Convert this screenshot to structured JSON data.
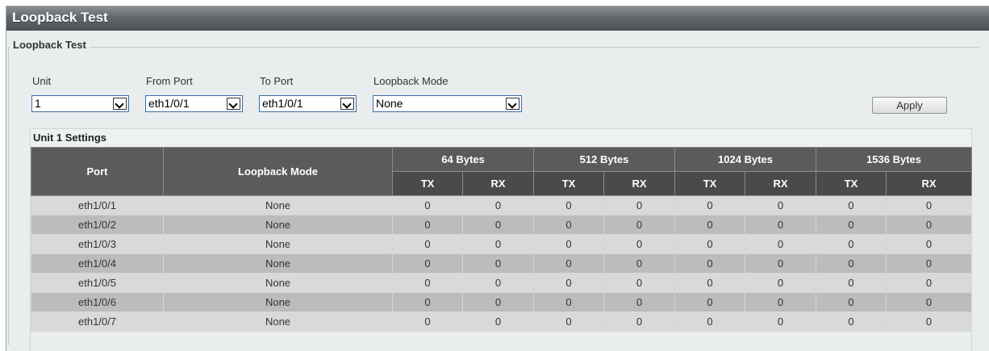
{
  "page": {
    "title": "Loopback Test"
  },
  "form": {
    "legend": "Loopback Test",
    "unit_label": "Unit",
    "unit_value": "1",
    "from_port_label": "From Port",
    "from_port_value": "eth1/0/1",
    "to_port_label": "To Port",
    "to_port_value": "eth1/0/1",
    "mode_label": "Loopback Mode",
    "mode_value": "None",
    "apply_label": "Apply"
  },
  "settings": {
    "title": "Unit 1 Settings",
    "headers": {
      "port": "Port",
      "mode": "Loopback Mode",
      "groups": [
        "64 Bytes",
        "512 Bytes",
        "1024 Bytes",
        "1536 Bytes"
      ],
      "tx": "TX",
      "rx": "RX"
    },
    "rows": [
      {
        "port": "eth1/0/1",
        "mode": "None",
        "values": [
          "0",
          "0",
          "0",
          "0",
          "0",
          "0",
          "0",
          "0"
        ]
      },
      {
        "port": "eth1/0/2",
        "mode": "None",
        "values": [
          "0",
          "0",
          "0",
          "0",
          "0",
          "0",
          "0",
          "0"
        ]
      },
      {
        "port": "eth1/0/3",
        "mode": "None",
        "values": [
          "0",
          "0",
          "0",
          "0",
          "0",
          "0",
          "0",
          "0"
        ]
      },
      {
        "port": "eth1/0/4",
        "mode": "None",
        "values": [
          "0",
          "0",
          "0",
          "0",
          "0",
          "0",
          "0",
          "0"
        ]
      },
      {
        "port": "eth1/0/5",
        "mode": "None",
        "values": [
          "0",
          "0",
          "0",
          "0",
          "0",
          "0",
          "0",
          "0"
        ]
      },
      {
        "port": "eth1/0/6",
        "mode": "None",
        "values": [
          "0",
          "0",
          "0",
          "0",
          "0",
          "0",
          "0",
          "0"
        ]
      },
      {
        "port": "eth1/0/7",
        "mode": "None",
        "values": [
          "0",
          "0",
          "0",
          "0",
          "0",
          "0",
          "0",
          "0"
        ]
      }
    ]
  }
}
